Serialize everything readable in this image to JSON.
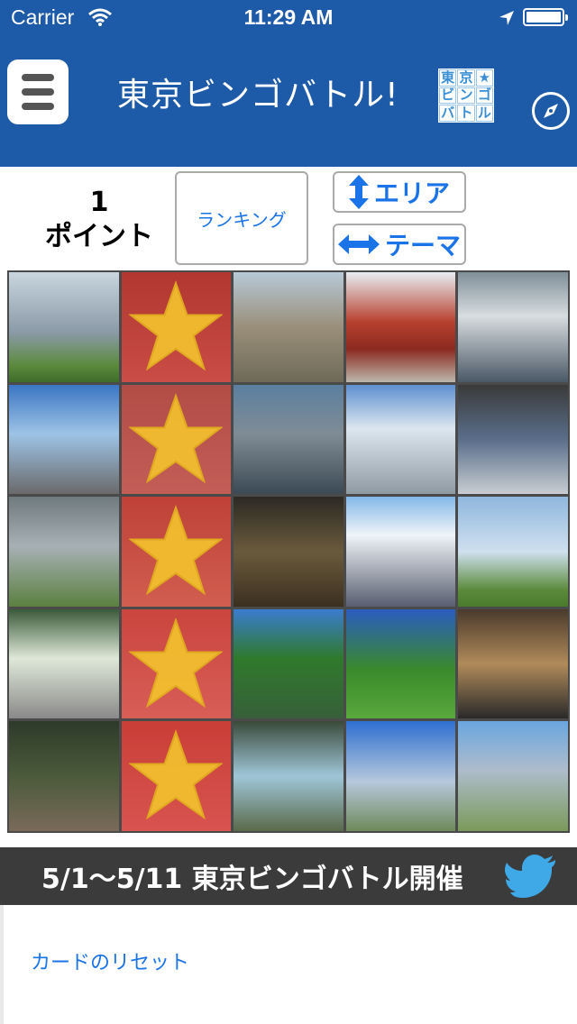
{
  "status_bar": {
    "carrier": "Carrier",
    "time": "11:29 AM"
  },
  "navbar": {
    "title": "東京ビンゴバトル!",
    "logo_text": [
      "東",
      "京",
      "★",
      "ビ",
      "ン",
      "ゴ",
      "バ",
      "ト",
      "ル"
    ]
  },
  "score": {
    "value": "1",
    "label": "ポイント"
  },
  "buttons": {
    "ranking": "ランキング",
    "area": "エリア",
    "theme": "テーマ"
  },
  "grid": {
    "columns": 5,
    "marked_column": 2,
    "cells": [
      "building-photo",
      "star-marked",
      "building-photo",
      "shrine-photo",
      "tower-photo",
      "street-photo",
      "star-marked",
      "station-photo",
      "street-photo",
      "bridge-photo",
      "fence-photo",
      "star-marked",
      "gate-photo",
      "building-photo",
      "bay-photo",
      "torii-photo",
      "star-marked",
      "park-photo",
      "garden-photo",
      "hall-photo",
      "statue-photo",
      "star-marked",
      "plaza-photo",
      "tower-photo",
      "building-photo"
    ]
  },
  "banner": {
    "text": "5/1〜5/11 東京ビンゴバトル開催"
  },
  "footer": {
    "reset_label": "カードのリセット"
  },
  "colors": {
    "nav": "#1d5aa8",
    "link": "#1a73e8",
    "mark": "#d22828",
    "star": "#f2c12e"
  }
}
